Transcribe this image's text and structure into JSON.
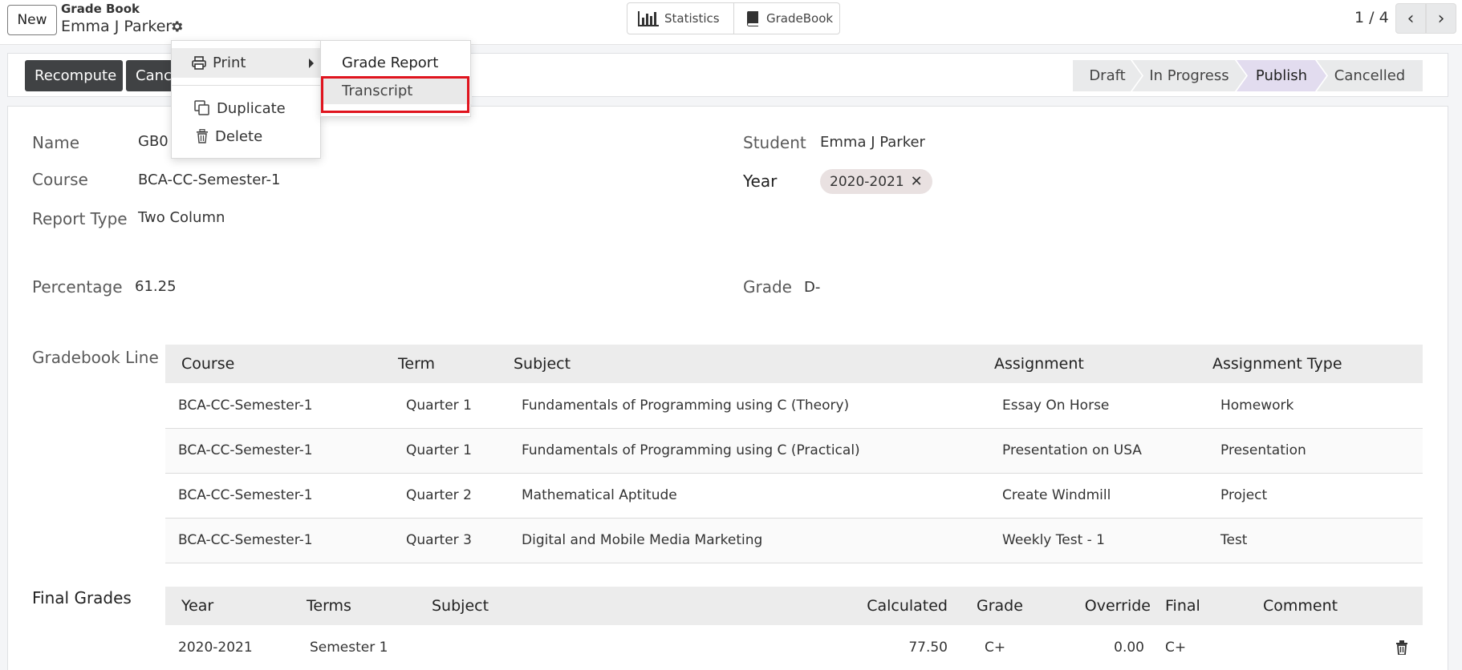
{
  "control_panel": {
    "new_label": "New",
    "breadcrumb_parent": "Grade Book",
    "breadcrumb_current": "Emma J Parker",
    "smart_buttons": {
      "statistics": "Statistics",
      "gradebook": "GradeBook"
    },
    "pager": {
      "value": "1 / 4",
      "prev": "‹",
      "next": "›"
    }
  },
  "statusbar": {
    "recompute_label": "Recompute",
    "cancel_label": "Cancel",
    "stages": [
      "Draft",
      "In Progress",
      "Publish",
      "Cancelled"
    ],
    "active_stage": "Publish",
    "active_color": "#e2dcef"
  },
  "action_menu": {
    "print_label": "Print",
    "duplicate_label": "Duplicate",
    "delete_label": "Delete",
    "print_submenu": [
      "Grade Report",
      "Transcript"
    ],
    "highlighted_item": "Transcript",
    "highlight_color": "#e0141e"
  },
  "form": {
    "name_label": "Name",
    "name_value": "GB0",
    "course_label": "Course",
    "course_value": "BCA-CC-Semester-1",
    "report_type_label": "Report Type",
    "report_type_value": "Two Column",
    "student_label": "Student",
    "student_value": "Emma J Parker",
    "year_label": "Year",
    "year_tag": "2020-2021",
    "percentage_label": "Percentage",
    "percentage_value": "61.25",
    "grade_label": "Grade",
    "grade_value": "D-"
  },
  "gradebook_lines": {
    "label": "Gradebook Line",
    "headers": [
      "Course",
      "Term",
      "Subject",
      "Assignment",
      "Assignment Type"
    ],
    "rows": [
      [
        "BCA-CC-Semester-1",
        "Quarter 1",
        "Fundamentals of Programming using C (Theory)",
        "Essay On Horse",
        "Homework"
      ],
      [
        "BCA-CC-Semester-1",
        "Quarter 1",
        "Fundamentals of Programming using C (Practical)",
        "Presentation on USA",
        "Presentation"
      ],
      [
        "BCA-CC-Semester-1",
        "Quarter 2",
        "Mathematical Aptitude",
        "Create Windmill",
        "Project"
      ],
      [
        "BCA-CC-Semester-1",
        "Quarter 3",
        "Digital and Mobile Media Marketing",
        "Weekly Test - 1",
        "Test"
      ]
    ]
  },
  "final_grades": {
    "label": "Final Grades",
    "headers": [
      "Year",
      "Terms",
      "Subject",
      "Calculated",
      "Grade",
      "Override",
      "Final",
      "Comment"
    ],
    "rows": [
      [
        "2020-2021",
        "Semester 1",
        "",
        "77.50",
        "C+",
        "0.00",
        "C+",
        ""
      ]
    ]
  },
  "icons": [
    "gear-icon",
    "bar-chart-icon",
    "book-icon",
    "chevron-left-icon",
    "chevron-right-icon",
    "printer-icon",
    "caret-right-icon",
    "copy-icon",
    "trash-icon",
    "close-icon"
  ]
}
